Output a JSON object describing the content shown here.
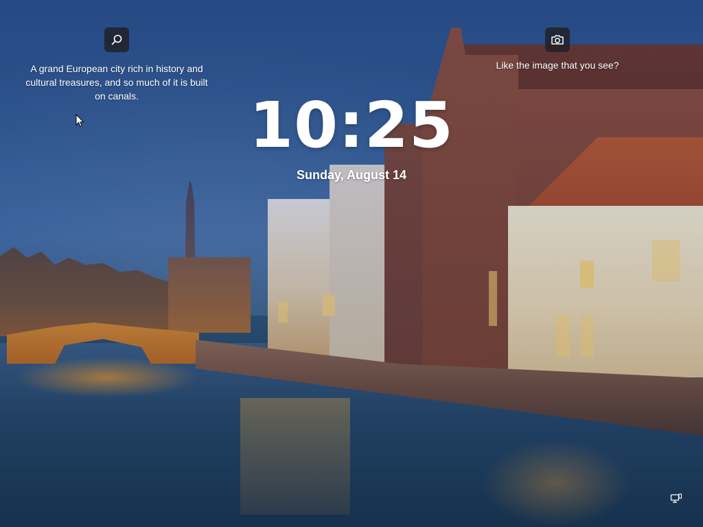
{
  "lock_screen": {
    "time": "10:25",
    "date": "Sunday, August 14"
  },
  "spotlight": {
    "info_icon": "search-icon",
    "description": "A grand European city rich in history and cultural treasures, and so much of it is built on canals.",
    "like_icon": "camera-icon",
    "like_prompt": "Like the image that you see?"
  },
  "system_tray": {
    "network_icon": "network-icon"
  },
  "colors": {
    "text": "#ffffff",
    "icon_button_bg": "#202024"
  }
}
